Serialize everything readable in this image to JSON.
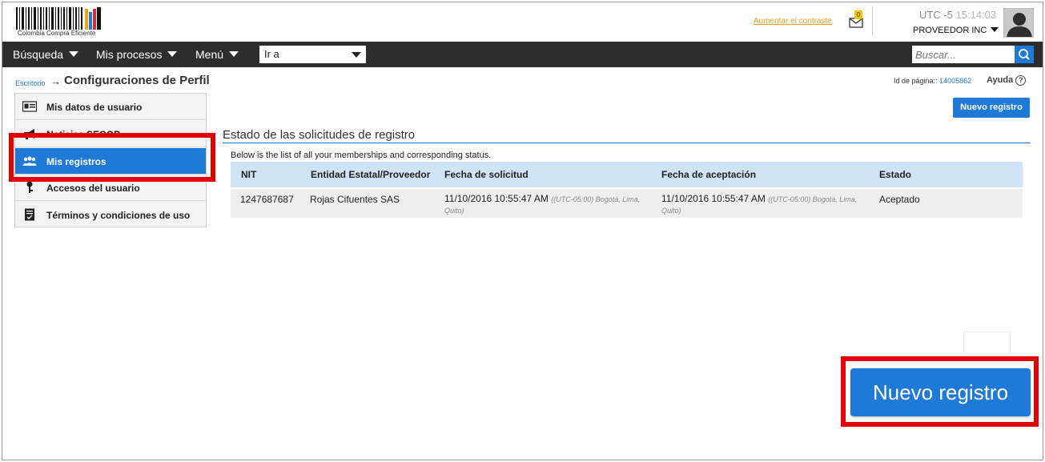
{
  "header": {
    "logo_text": "Colombia Compra Eficiente",
    "contrast_link": "Aumentar el contraste",
    "mail_badge": "0",
    "timezone": "UTC -5",
    "time": "15:14:03",
    "user_name": "PROVEEDOR INC"
  },
  "nav": {
    "items": [
      "Búsqueda",
      "Mis procesos",
      "Menú"
    ],
    "goto_value": "Ir a",
    "search_placeholder": "Buscar..."
  },
  "breadcrumb": {
    "home": "Escritorio",
    "arrow": "→",
    "title": "Configuraciones de Perfil"
  },
  "page_info": {
    "id_label": "Id de página::",
    "id_value": "14005862",
    "help_label": "Ayuda",
    "help_glyph": "?"
  },
  "sidebar": {
    "items": [
      {
        "label": "Mis datos de usuario",
        "icon": "id-card-icon"
      },
      {
        "label": "Noticias SECOP",
        "icon": "megaphone-icon"
      },
      {
        "label": "Mis registros",
        "icon": "users-icon",
        "active": true
      },
      {
        "label": "Accesos del usuario",
        "icon": "key-icon"
      },
      {
        "label": "Términos y condiciones de uso",
        "icon": "document-icon"
      }
    ]
  },
  "main": {
    "new_button_label": "Nuevo registro",
    "section_title": "Estado de las solicitudes de registro",
    "description": "Below is the list of all your memberships and corresponding status.",
    "table": {
      "headers": [
        "NIT",
        "Entidad Estatal/Proveedor",
        "Fecha de solicitud",
        "Fecha de aceptación",
        "Estado"
      ],
      "rows": [
        {
          "nit": "1247687687",
          "entity": "Rojas Cifuentes SAS",
          "request_date": "11/10/2016 10:55:47 AM",
          "request_tz": "((UTC-05:00) Bogotá, Lima, Quito)",
          "accept_date": "11/10/2016 10:55:47 AM",
          "accept_tz": "((UTC-05:00) Bogotá, Lima, Quito)",
          "status": "Aceptado"
        }
      ]
    }
  },
  "callout": {
    "big_button_label": "Nuevo registro",
    "highlight_color": "#e20000"
  },
  "colors": {
    "accent": "#1e7ad6",
    "navbar": "#2d2d2d",
    "table_header": "#cfe3f7",
    "link_orange": "#e8a317"
  }
}
